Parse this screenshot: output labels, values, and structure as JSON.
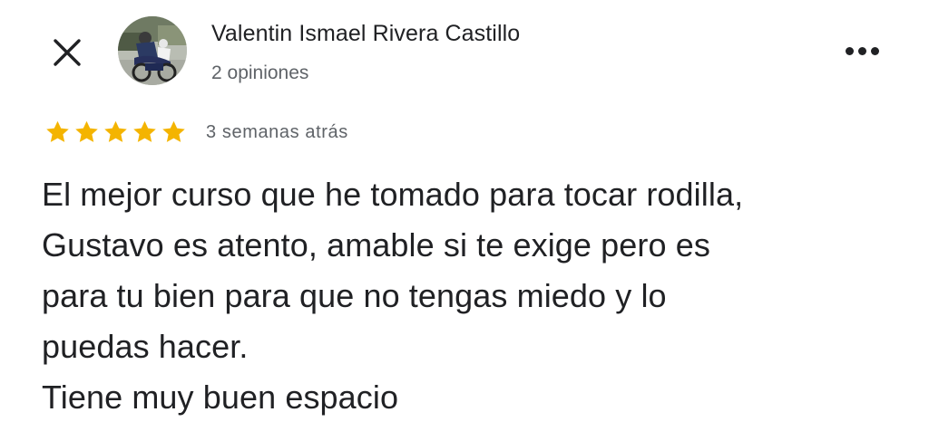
{
  "header": {
    "reviewer_name": "Valentin Ismael Rivera Castillo",
    "review_count": "2 opiniones"
  },
  "icons": {
    "close": "close-icon",
    "more": "more-horizontal-icon",
    "star": "star-icon"
  },
  "review": {
    "rating": 5,
    "rating_max": 5,
    "time_ago": "3 semanas atrás",
    "text": "El mejor curso que he tomado para tocar rodilla,\nGustavo es atento, amable si te exige pero es\npara tu bien para que no tengas miedo y lo\npuedas hacer.\nTiene muy buen espacio"
  },
  "colors": {
    "star": "#f4b400",
    "text_primary": "#202124",
    "text_secondary": "#5f6368"
  }
}
